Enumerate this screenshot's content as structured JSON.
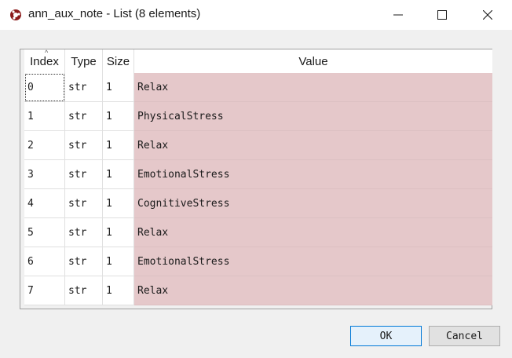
{
  "window": {
    "title": "ann_aux_note - List (8 elements)",
    "icon": "spyder-app-icon"
  },
  "table": {
    "sort_indicator": "^",
    "columns": [
      "Index",
      "Type",
      "Size",
      "Value"
    ],
    "rows": [
      {
        "index": "0",
        "type": "str",
        "size": "1",
        "value": "Relax"
      },
      {
        "index": "1",
        "type": "str",
        "size": "1",
        "value": "PhysicalStress"
      },
      {
        "index": "2",
        "type": "str",
        "size": "1",
        "value": "Relax"
      },
      {
        "index": "3",
        "type": "str",
        "size": "1",
        "value": "EmotionalStress"
      },
      {
        "index": "4",
        "type": "str",
        "size": "1",
        "value": "CognitiveStress"
      },
      {
        "index": "5",
        "type": "str",
        "size": "1",
        "value": "Relax"
      },
      {
        "index": "6",
        "type": "str",
        "size": "1",
        "value": "EmotionalStress"
      },
      {
        "index": "7",
        "type": "str",
        "size": "1",
        "value": "Relax"
      }
    ],
    "value_cell_color": "#e5c8ca"
  },
  "buttons": {
    "ok_label": "OK",
    "cancel_label": "Cancel"
  }
}
